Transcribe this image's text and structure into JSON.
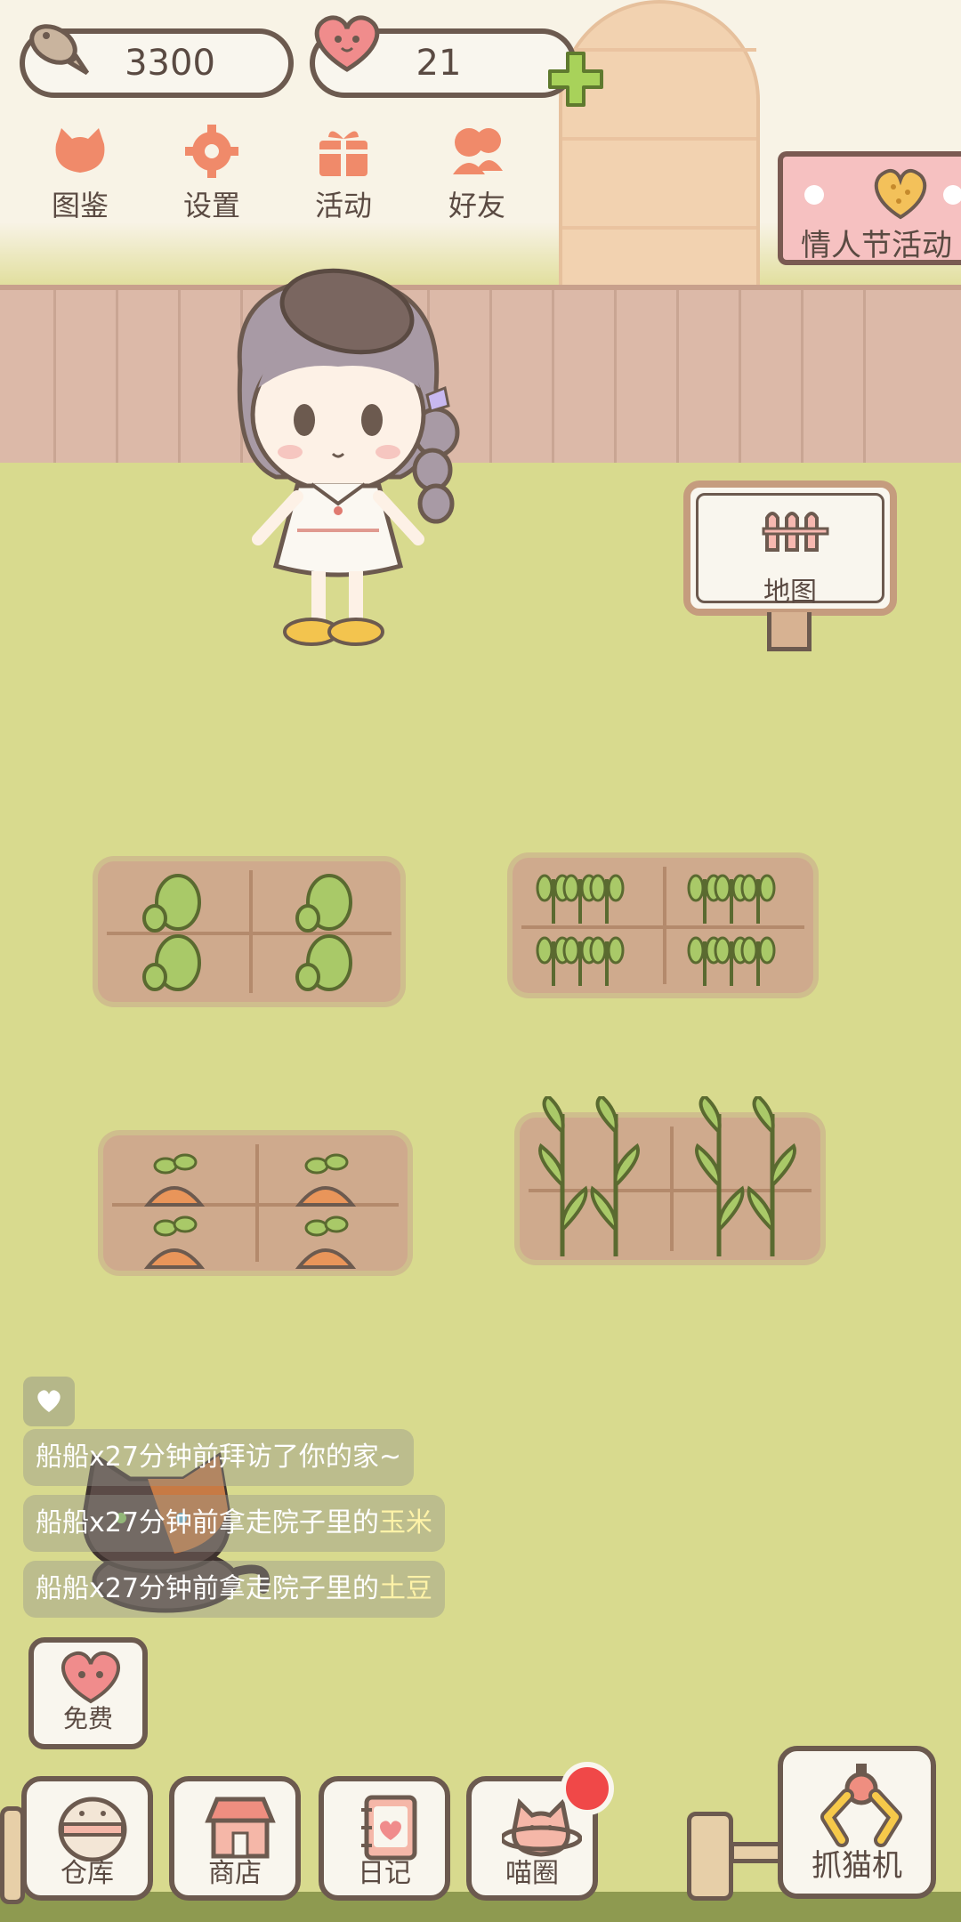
{
  "resources": {
    "fish_amount": "3300",
    "heart_amount": "21"
  },
  "top_menu": [
    {
      "label": "图鉴",
      "icon": "cat-head-icon"
    },
    {
      "label": "设置",
      "icon": "gear-icon"
    },
    {
      "label": "活动",
      "icon": "gift-icon"
    },
    {
      "label": "好友",
      "icon": "friends-icon"
    }
  ],
  "event_banner": {
    "label": "情人节活动"
  },
  "map_sign": {
    "label": "地图"
  },
  "activity_feed": [
    {
      "prefix": "船船x27分钟前拜访了你的家~",
      "item": ""
    },
    {
      "prefix": "船船x27分钟前拿走院子里的",
      "item": "玉米"
    },
    {
      "prefix": "船船x27分钟前拿走院子里的",
      "item": "土豆"
    }
  ],
  "free_button": {
    "label": "免费"
  },
  "bottom_nav": [
    {
      "label": "仓库",
      "icon": "storage-icon"
    },
    {
      "label": "商店",
      "icon": "shop-icon"
    },
    {
      "label": "日记",
      "icon": "diary-icon"
    },
    {
      "label": "喵圈",
      "icon": "cat-planet-icon"
    }
  ],
  "claw_machine": {
    "label": "抓猫机"
  },
  "colors": {
    "outline": "#6c5a4f",
    "heart": "#f08c8c",
    "grass": "#d8da8e",
    "soil": "#cfaa8d",
    "plus": "#a8d25a",
    "badge": "#f04848"
  }
}
